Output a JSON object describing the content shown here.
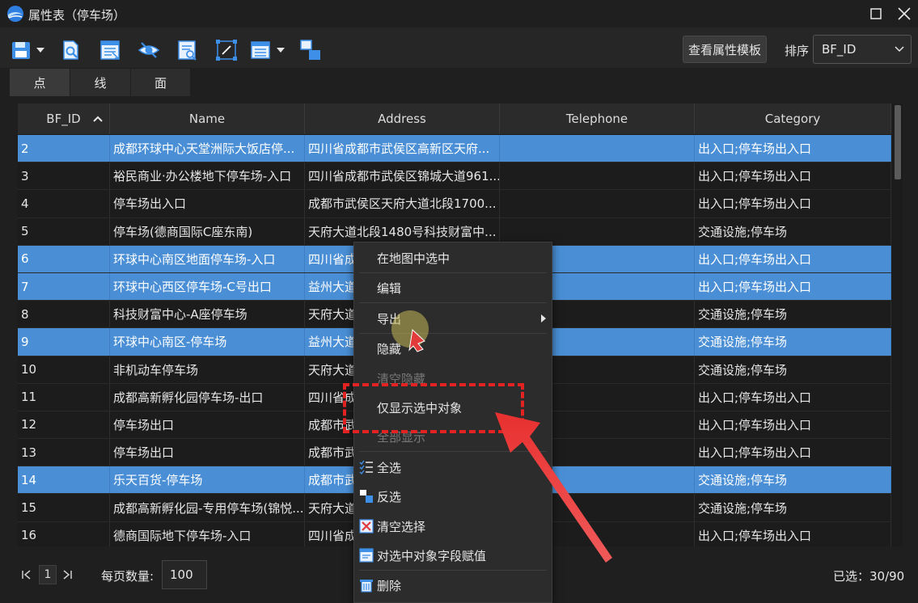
{
  "window": {
    "title": "属性表（停车场）"
  },
  "toolbar": {
    "template_button": "查看属性模板",
    "sort_label": "排序",
    "sort_value": "BF_ID",
    "icons": [
      "save-icon",
      "zoom-to-icon",
      "select-field-icon",
      "hide-eye-icon",
      "search-icon",
      "resize-icon",
      "list-view-icon",
      "switch-icon"
    ]
  },
  "tabs": [
    {
      "label": "点",
      "active": true
    },
    {
      "label": "线",
      "active": false
    },
    {
      "label": "面",
      "active": false
    }
  ],
  "table": {
    "columns": [
      "BF_ID",
      "Name",
      "Address",
      "Telephone",
      "Category"
    ],
    "rows": [
      {
        "id": "2",
        "name": "成都环球中心天堂洲际大饭店停...",
        "address": "四川省成都市武侯区高新区天府...",
        "tel": "",
        "category": "出入口;停车场出入口",
        "selected": true
      },
      {
        "id": "3",
        "name": "裕民商业·办公楼地下停车场-入口",
        "address": "四川省成都市武侯区锦城大道961...",
        "tel": "",
        "category": "出入口;停车场出入口",
        "selected": false
      },
      {
        "id": "4",
        "name": "停车场出入口",
        "address": "成都市武侯区天府大道北段1700...",
        "tel": "",
        "category": "出入口;停车场出入口",
        "selected": false
      },
      {
        "id": "5",
        "name": "停车场(德商国际C座东南)",
        "address": "天府大道北段1480号科技财富中...",
        "tel": "",
        "category": "交通设施;停车场",
        "selected": false
      },
      {
        "id": "6",
        "name": "环球中心南区地面停车场-入口",
        "address": "四川省成",
        "tel": "",
        "category": "出入口;停车场出入口",
        "selected": true
      },
      {
        "id": "7",
        "name": "环球中心西区停车场-C号出口",
        "address": "益州大道",
        "tel": "",
        "category": "出入口;停车场出入口",
        "selected": true
      },
      {
        "id": "8",
        "name": "科技财富中心-A座停车场",
        "address": "天府大道",
        "tel": "",
        "category": "交通设施;停车场",
        "selected": false
      },
      {
        "id": "9",
        "name": "环球中心南区-停车场",
        "address": "益州大道",
        "tel": "",
        "category": "交通设施;停车场",
        "selected": true
      },
      {
        "id": "10",
        "name": "非机动车停车场",
        "address": "天府大道",
        "tel": "",
        "category": "交通设施;停车场",
        "selected": false
      },
      {
        "id": "11",
        "name": "成都高新孵化园停车场-出口",
        "address": "四川省成",
        "tel": "",
        "category": "出入口;停车场出入口",
        "selected": false
      },
      {
        "id": "12",
        "name": "停车场出口",
        "address": "成都市武",
        "tel": "",
        "category": "出入口;停车场出入口",
        "selected": false
      },
      {
        "id": "13",
        "name": "停车场出口",
        "address": "成都市武",
        "tel": "",
        "category": "出入口;停车场出入口",
        "selected": false
      },
      {
        "id": "14",
        "name": "乐天百货-停车场",
        "address": "成都市武",
        "tel": "",
        "category": "交通设施;停车场",
        "selected": true
      },
      {
        "id": "15",
        "name": "成都高新孵化园-专用停车场(锦悦...",
        "address": "天府大道",
        "tel": "",
        "category": "交通设施;停车场",
        "selected": false
      },
      {
        "id": "16",
        "name": "德商国际地下停车场-入口",
        "address": "四川省成",
        "tel": "",
        "category": "出入口;停车场出入口",
        "selected": false
      }
    ]
  },
  "pagination": {
    "current_page": "1",
    "per_page_label": "每页数量:",
    "per_page_value": "100",
    "selected_count": "已选：30/90"
  },
  "context_menu": {
    "items": [
      {
        "label": "在地图中选中",
        "enabled": true
      },
      {
        "label": "编辑",
        "enabled": true
      },
      {
        "label": "导出",
        "enabled": true,
        "submenu": true
      },
      {
        "label": "隐藏",
        "enabled": true
      },
      {
        "label": "清空隐藏",
        "enabled": false
      },
      {
        "label": "仅显示选中对象",
        "enabled": true
      },
      {
        "label": "全部显示",
        "enabled": false
      },
      {
        "label": "全选",
        "enabled": true,
        "icon": "select-all-icon"
      },
      {
        "label": "反选",
        "enabled": true,
        "icon": "invert-selection-icon"
      },
      {
        "label": "清空选择",
        "enabled": true,
        "icon": "clear-selection-icon"
      },
      {
        "label": "对选中对象字段赋值",
        "enabled": true,
        "icon": "assign-field-icon"
      },
      {
        "label": "删除",
        "enabled": true,
        "icon": "delete-icon"
      }
    ]
  },
  "colors": {
    "selected_row": "#4a8fd6",
    "annotation_red": "#e32222",
    "background": "#1f1f1f"
  }
}
